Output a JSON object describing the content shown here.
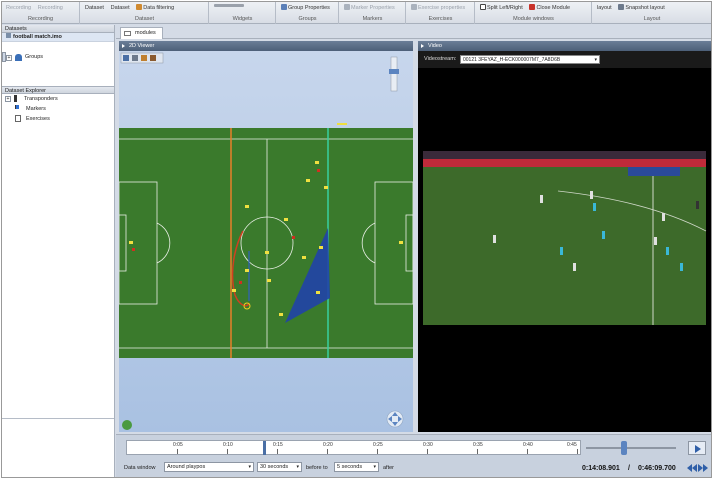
{
  "ribbon": {
    "groups": [
      {
        "label": "Recording",
        "buttons": [
          {
            "text": "Recording",
            "icon": "recording-icon",
            "disabled": true
          },
          {
            "text": "Recording",
            "icon": "recording-icon",
            "disabled": true
          }
        ]
      },
      {
        "label": "Dataset",
        "buttons": [
          {
            "text": "Dataset",
            "icon": "dataset-icon",
            "disabled": false
          },
          {
            "text": "Dataset",
            "icon": "dataset-icon",
            "disabled": false
          },
          {
            "text": "Data filtering",
            "icon": "filter-icon",
            "disabled": false
          }
        ]
      },
      {
        "label": "Widgets",
        "buttons": [
          {
            "text": "",
            "icon": "widget-icon",
            "disabled": true
          }
        ]
      },
      {
        "label": "Groups",
        "buttons": [
          {
            "text": "Group Properties",
            "icon": "group-properties-icon",
            "disabled": false
          }
        ]
      },
      {
        "label": "Markers",
        "buttons": [
          {
            "text": "Marker Properties",
            "icon": "marker-properties-icon",
            "disabled": true
          }
        ]
      },
      {
        "label": "Exercises",
        "buttons": [
          {
            "text": "Exercise properties",
            "icon": "exercise-properties-icon",
            "disabled": true
          }
        ]
      },
      {
        "label": "Module windows",
        "buttons": [
          {
            "text": "Split Left/Right",
            "icon": "split-icon",
            "disabled": false
          },
          {
            "text": "Close Module",
            "icon": "close-module-icon",
            "disabled": false
          }
        ]
      },
      {
        "label": "Layout",
        "buttons": [
          {
            "text": "layout",
            "icon": "layout-icon",
            "disabled": false
          },
          {
            "text": "Snapshot layout",
            "icon": "snapshot-icon",
            "disabled": false
          }
        ]
      }
    ]
  },
  "datasets": {
    "header": "Datasets",
    "selected": "football match.imo"
  },
  "explorer": {
    "header": "Dataset Explorer",
    "items": [
      {
        "label": "Transponders",
        "expander": "+"
      },
      {
        "label": "Groups",
        "expander": "+"
      },
      {
        "label": "Markers",
        "expander": ""
      },
      {
        "label": "Exercises",
        "expander": ""
      }
    ]
  },
  "tabs": {
    "modules": "modules"
  },
  "viewer": {
    "title": "2D Viewer"
  },
  "video": {
    "title": "Video",
    "source_label": "Videostream:",
    "source_value": "00121 3FEYAZ_H-ECK000007M7_7A8D6B"
  },
  "timeline": {
    "ticks": [
      "0:05",
      "0:10",
      "0:15",
      "0:20",
      "0:25",
      "0:30",
      "0:35",
      "0:40",
      "0:45"
    ],
    "data_window_label": "Data window",
    "data_window_value": "Around playpos",
    "duration_value": "30 seconds",
    "before_label": "before to",
    "before_value": "5 seconds",
    "after_label": "after",
    "current_time": "0:14:08.901",
    "separator": "/",
    "total_time": "0:46:09.700"
  },
  "colors": {
    "pitch": "#3a7a2c",
    "sky": "#b9cce8",
    "accent": "#2f5fa8",
    "formation": "#2142a8"
  }
}
